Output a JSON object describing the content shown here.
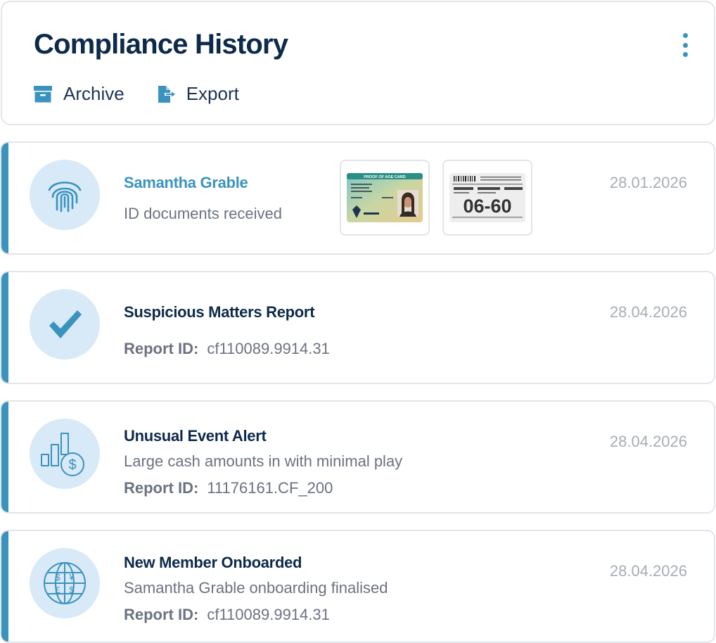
{
  "header": {
    "title": "Compliance History",
    "actions": [
      {
        "label": "Archive",
        "icon": "archive-icon"
      },
      {
        "label": "Export",
        "icon": "export-icon"
      }
    ],
    "menu_icon": "kebab-menu-icon"
  },
  "colors": {
    "accent": "#3a93be",
    "title": "#0d2a4a",
    "muted": "#6b7280",
    "date": "#a6adb6",
    "icon_bg": "#d8e9f7"
  },
  "items": [
    {
      "icon": "fingerprint-icon",
      "title": "Samantha Grable",
      "subtitle": "ID documents received",
      "date": "28.01.2026",
      "attachments": [
        {
          "name": "proof-of-age-card",
          "header": "PROOF OF AGE CARD"
        },
        {
          "name": "id-card-back",
          "big_text": "06-60"
        }
      ]
    },
    {
      "icon": "checkmark-icon",
      "title": "Suspicious Matters Report",
      "report_label": "Report ID:",
      "report_id": "cf110089.9914.31",
      "date": "28.04.2026"
    },
    {
      "icon": "chart-dollar-icon",
      "title": "Unusual Event Alert",
      "subtitle": "Large cash amounts in with minimal play",
      "report_label": "Report ID:",
      "report_id": "11176161.CF_200",
      "date": "28.04.2026"
    },
    {
      "icon": "globe-currency-icon",
      "title": "New Member Onboarded",
      "subtitle": "Samantha Grable onboarding finalised",
      "report_label": "Report ID:",
      "report_id": "cf110089.9914.31",
      "date": "28.04.2026"
    }
  ]
}
